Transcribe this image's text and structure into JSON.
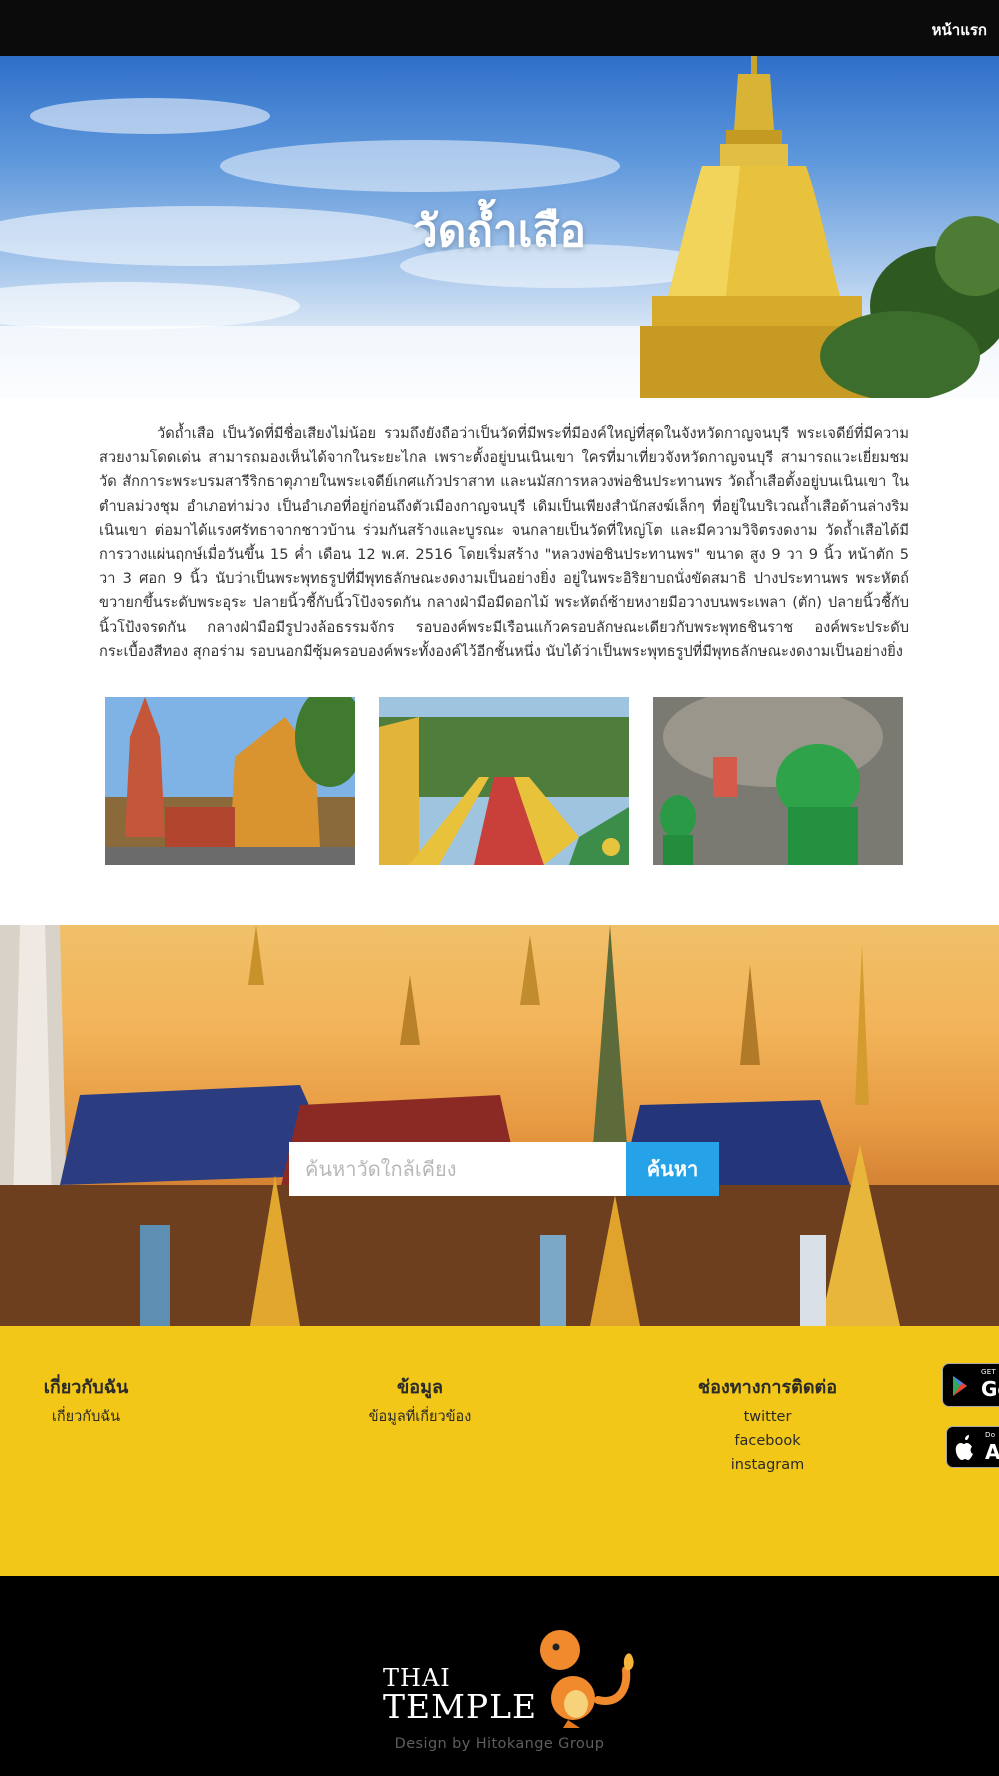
{
  "nav": {
    "home": "หน้าแรก"
  },
  "hero": {
    "title": "วัดถ้ำเสือ"
  },
  "article": {
    "body": "วัดถ้ำเสือ เป็นวัดที่มีชื่อเสียงไม่น้อย รวมถึงยังถือว่าเป็นวัดที่มีพระที่มีองค์ใหญ่ที่สุดในจังหวัดกาญจนบุรี พระเจดีย์ที่มีความสวยงามโดดเด่น สามารถมองเห็นได้จากในระยะไกล เพราะตั้งอยู่บนเนินเขา ใครที่มาเที่ยวจังหวัดกาญจนบุรี สามารถแวะเยี่ยมชมวัด สักการะพระบรมสารีริกธาตุภายในพระเจดีย์เกศแก้วปราสาท และนมัสการหลวงพ่อชินประทานพร วัดถ้ำเสือตั้งอยู่บนเนินเขา ในตำบลม่วงชุม อำเภอท่าม่วง เป็นอำเภอที่อยู่ก่อนถึงตัวเมืองกาญจนบุรี เดิมเป็นเพียงสำนักสงฆ์เล็กๆ ที่อยู่ในบริเวณถ้ำเสือด้านล่างริมเนินเขา ต่อมาได้แรงศรัทธาจากชาวบ้าน ร่วมกันสร้างและบูรณะ จนกลายเป็นวัดที่ใหญ่โต และมีความวิจิตรงดงาม วัดถ้ำเสือได้มีการวางแผ่นฤกษ์เมื่อวันขึ้น 15 ค่ำ เดือน 12 พ.ศ. 2516 โดยเริ่มสร้าง \"หลวงพ่อชินประทานพร\" ขนาด สูง 9 วา 9 นิ้ว หน้าตัก 5 วา 3 ศอก 9 นิ้ว นับว่าเป็นพระพุทธรูปที่มีพุทธลักษณะงดงามเป็นอย่างยิ่ง อยู่ในพระอิริยาบถนั่งขัดสมาธิ ปางประทานพร พระหัตถ์ขวายกขึ้นระดับพระอุระ ปลายนิ้วชี้กับนิ้วโป้งจรดกัน กลางฝ่ามือมีดอกไม้ พระหัตถ์ซ้ายหงายมีอวางบนพระเพลา (ตัก) ปลายนิ้วชี้กับนิ้วโป้งจรดกัน กลางฝ่ามือมีรูปวงล้อธรรมจักร รอบองค์พระมีเรือนแก้วครอบลักษณะเดียวกับพระพุทธชินราช องค์พระประดับกระเบื้องสีทอง สุกอร่าม รอบนอกมีซุ้มครอบองค์พระทั้งองค์ไว้อีกชั้นหนึ่ง นับได้ว่าเป็นพระพุทธรูปที่มีพุทธลักษณะงดงามเป็นอย่างยิ่ง"
  },
  "search": {
    "placeholder": "ค้นหาวัดใกล้เคียง",
    "button": "ค้นหา"
  },
  "footer": {
    "about": {
      "title": "เกี่ยวกับฉัน",
      "link": "เกี่ยวกับฉัน"
    },
    "info": {
      "title": "ข้อมูล",
      "link": "ข้อมูลที่เกี่ยวข้อง"
    },
    "contact": {
      "title": "ช่องทางการติดต่อ",
      "links": [
        "twitter",
        "facebook",
        "instagram"
      ]
    },
    "stores": {
      "google": {
        "small": "GET IT ON",
        "big": "Go"
      },
      "apple": {
        "small": "Do",
        "big": "A"
      }
    }
  },
  "logo": {
    "line1": "THAI",
    "line2": "TEMPLE"
  },
  "credit": "Design by Hitokange Group",
  "colors": {
    "nav": "#0b0b0b",
    "footer": "#f2c718",
    "search_button": "#26a3e8",
    "bottom": "#000000"
  }
}
